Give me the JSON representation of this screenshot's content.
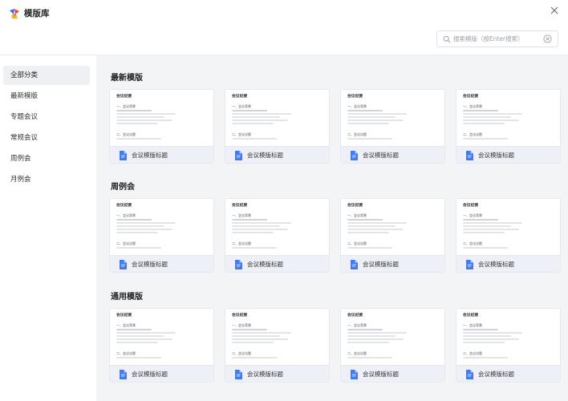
{
  "header": {
    "title": "模版库"
  },
  "search": {
    "placeholder": "搜索模版（按Enter搜索）"
  },
  "sidebar": {
    "items": [
      {
        "label": "全部分类",
        "active": true
      },
      {
        "label": "最新模版",
        "active": false
      },
      {
        "label": "专题会议",
        "active": false
      },
      {
        "label": "常规会议",
        "active": false
      },
      {
        "label": "周例会",
        "active": false
      },
      {
        "label": "月例会",
        "active": false
      }
    ]
  },
  "sections": [
    {
      "title": "最新模版",
      "cards": [
        {
          "doc_title": "会议纪要",
          "sec1": "一、会议背景",
          "sec2": "二、会议议题",
          "label": "会议模版标题"
        },
        {
          "doc_title": "会议纪要",
          "sec1": "一、会议背景",
          "sec2": "二、会议议题",
          "label": "会议模版标题"
        },
        {
          "doc_title": "会议纪要",
          "sec1": "一、会议背景",
          "sec2": "二、会议议题",
          "label": "会议模版标题"
        },
        {
          "doc_title": "会议纪要",
          "sec1": "一、会议背景",
          "sec2": "二、会议议题",
          "label": "会议模版标题"
        }
      ]
    },
    {
      "title": "周例会",
      "cards": [
        {
          "doc_title": "会议纪要",
          "sec1": "一、会议背景",
          "sec2": "二、会议议题",
          "label": "会议模版标题"
        },
        {
          "doc_title": "会议纪要",
          "sec1": "一、会议背景",
          "sec2": "二、会议议题",
          "label": "会议模版标题"
        },
        {
          "doc_title": "会议纪要",
          "sec1": "一、会议背景",
          "sec2": "二、会议议题",
          "label": "会议模版标题"
        },
        {
          "doc_title": "会议纪要",
          "sec1": "一、会议背景",
          "sec2": "二、会议议题",
          "label": "会议模版标题"
        }
      ]
    },
    {
      "title": "通用模版",
      "cards": [
        {
          "doc_title": "会议纪要",
          "sec1": "一、会议背景",
          "sec2": "二、会议议题",
          "label": "会议模版标题"
        },
        {
          "doc_title": "会议纪要",
          "sec1": "一、会议背景",
          "sec2": "二、会议议题",
          "label": "会议模版标题"
        },
        {
          "doc_title": "会议纪要",
          "sec1": "一、会议背景",
          "sec2": "二、会议议题",
          "label": "会议模版标题"
        },
        {
          "doc_title": "会议纪要",
          "sec1": "一、会议背景",
          "sec2": "二、会议议题",
          "label": "会议模版标题"
        }
      ]
    }
  ],
  "icons": {
    "logo": "app-logo-icon",
    "close": "close-icon",
    "search": "search-icon",
    "clear": "clear-icon",
    "file": "document-icon"
  },
  "colors": {
    "accent": "#3f7bf6",
    "sidebar_active_bg": "#eef0f3",
    "content_bg": "#f3f4f6",
    "card_footer_bg": "#edf1f7"
  }
}
